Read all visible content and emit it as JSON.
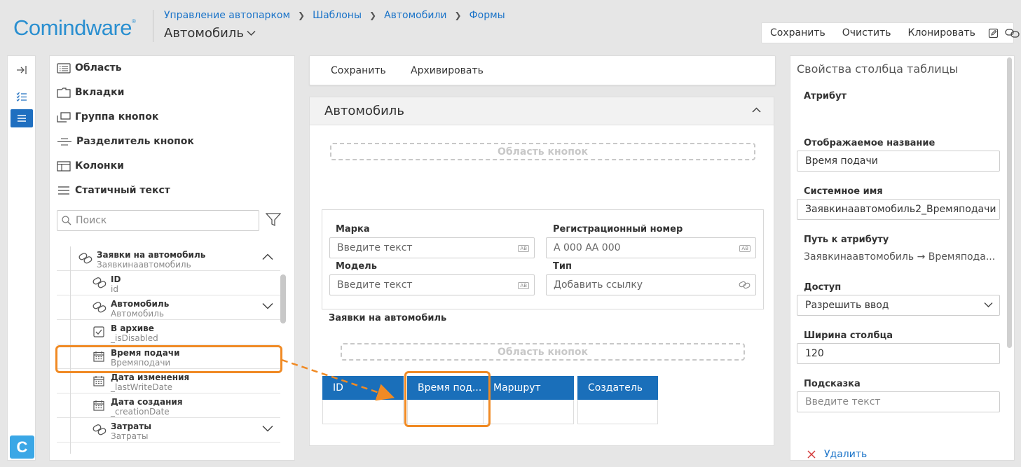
{
  "app": {
    "logo_text": "Comindware",
    "logo_mark": "®"
  },
  "breadcrumb": [
    "Управление автопарком",
    "Шаблоны",
    "Автомобили",
    "Формы"
  ],
  "page_title": "Автомобиль",
  "top_toolbar": {
    "save": "Сохранить",
    "clear": "Очистить",
    "clone": "Клонировать"
  },
  "rail": {
    "c_label": "C"
  },
  "components": [
    "Область",
    "Вкладки",
    "Группа кнопок",
    "Разделитель кнопок",
    "Колонки",
    "Статичный текст"
  ],
  "search": {
    "placeholder": "Поиск"
  },
  "tree": [
    {
      "title": "Заявки на автомобиль",
      "sub": "Заявкинаавтомобиль",
      "icon": "link-icon",
      "expand": "up"
    },
    {
      "title": "ID",
      "sub": "id",
      "icon": "link-icon",
      "expand": ""
    },
    {
      "title": "Автомобиль",
      "sub": "Автомобиль",
      "icon": "link-icon",
      "expand": "down"
    },
    {
      "title": "В архиве",
      "sub": "_isDisabled",
      "icon": "checkbox-icon",
      "expand": ""
    },
    {
      "title": "Время подачи",
      "sub": "Времяподачи",
      "icon": "calendar-icon",
      "expand": ""
    },
    {
      "title": "Дата изменения",
      "sub": "_lastWriteDate",
      "icon": "calendar-icon",
      "expand": ""
    },
    {
      "title": "Дата создания",
      "sub": "_creationDate",
      "icon": "calendar-icon",
      "expand": ""
    },
    {
      "title": "Затраты",
      "sub": "Затраты",
      "icon": "link-icon",
      "expand": "down"
    }
  ],
  "center_toolbar": {
    "save": "Сохранить",
    "archive": "Архивировать"
  },
  "form": {
    "title": "Автомобиль",
    "button_area": "Область кнопок",
    "fields": {
      "marka": {
        "label": "Марка",
        "placeholder": "Введите текст"
      },
      "reg_number": {
        "label": "Регистрационный номер",
        "placeholder": "А 000 АА 000"
      },
      "model": {
        "label": "Модель",
        "placeholder": "Введите текст"
      },
      "type": {
        "label": "Тип",
        "placeholder": "Добавить ссылку"
      }
    },
    "input_badge": "AB",
    "table_label": "Заявки на автомобиль",
    "table_columns": [
      "ID",
      "Время под...",
      "Маршрут",
      "Создатель"
    ]
  },
  "props": {
    "title": "Свойства столбца таблицы",
    "attribute_label": "Атрибут",
    "display_name_label": "Отображаемое название",
    "display_name_value": "Время подачи",
    "system_name_label": "Системное имя",
    "system_name_value": "Заявкинаавтомобиль2_Времяподачи",
    "path_label": "Путь к атрибуту",
    "path_value": "Заявкинаавтомобиль → Времяпода...",
    "access_label": "Доступ",
    "access_value": "Разрешить ввод",
    "width_label": "Ширина столбца",
    "width_value": "120",
    "hint_label": "Подсказка",
    "hint_placeholder": "Введите текст",
    "delete": "Удалить"
  },
  "colors": {
    "accent": "#1a6fba",
    "link": "#1a73c8",
    "highlight": "#f08a24",
    "logo": "#2a8fd0"
  }
}
